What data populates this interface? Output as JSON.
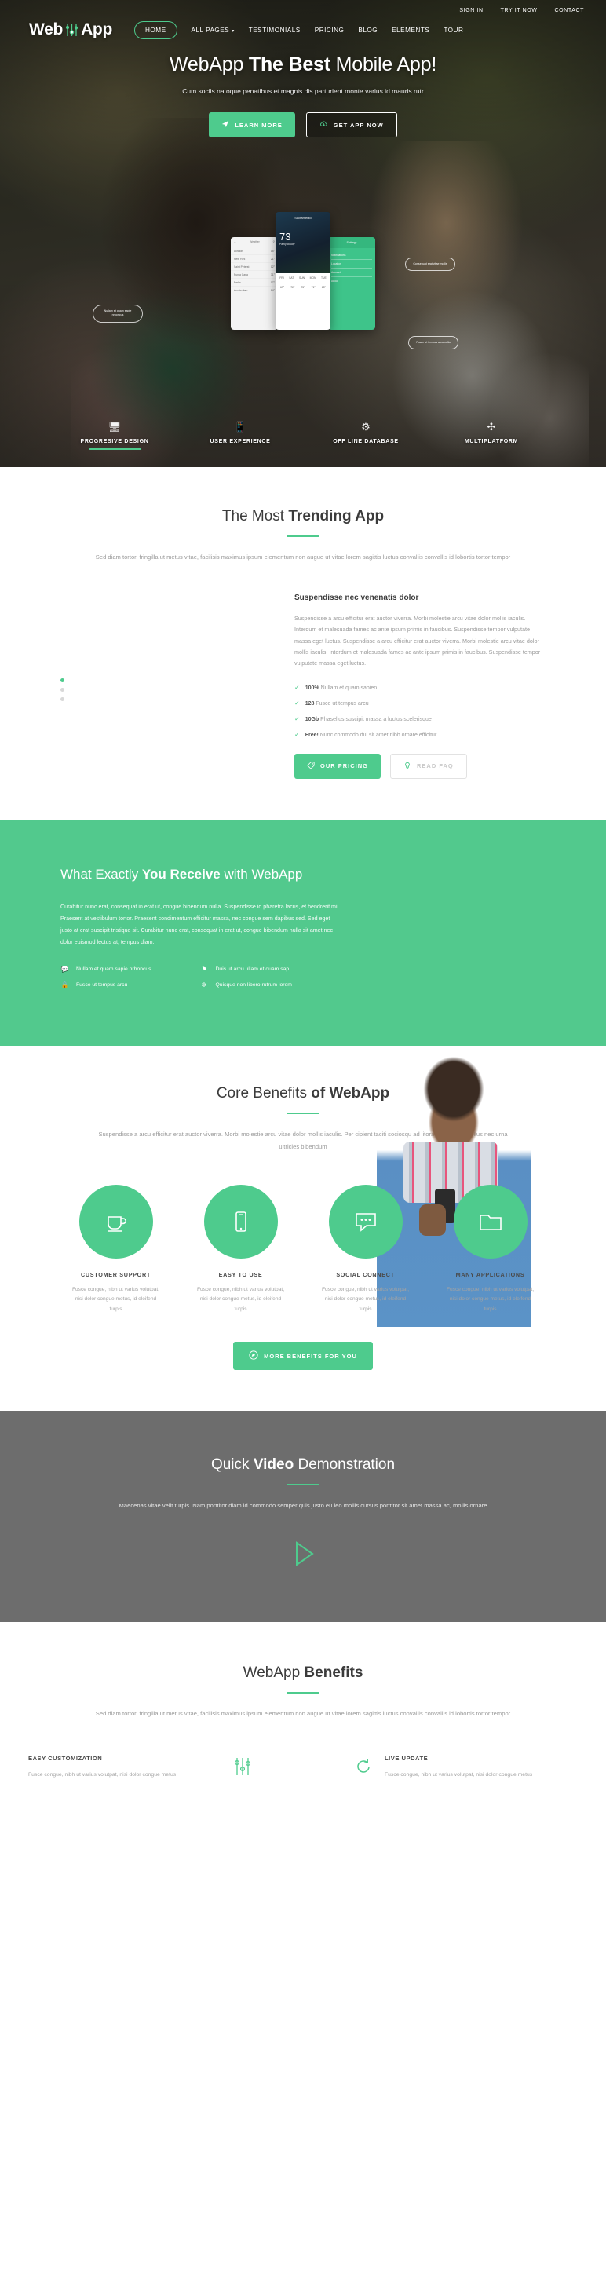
{
  "brand": {
    "name_light": "Web",
    "name_bold": "App",
    "logo_icon": "sliders-icon"
  },
  "accent": "#4ecb8d",
  "green_bg": "#52c98d",
  "utility_nav": [
    {
      "label": "SIGN IN"
    },
    {
      "label": "TRY IT NOW"
    },
    {
      "label": "CONTACT"
    }
  ],
  "main_nav": [
    {
      "label": "HOME",
      "active": true
    },
    {
      "label": "ALL PAGES",
      "caret": "⌵"
    },
    {
      "label": "TESTIMONIALS"
    },
    {
      "label": "PRICING"
    },
    {
      "label": "BLOG"
    },
    {
      "label": "ELEMENTS"
    },
    {
      "label": "TOUR"
    }
  ],
  "hero": {
    "title_pre": "WebApp ",
    "title_bold": "The Best",
    "title_post": " Mobile App!",
    "subtitle": "Cum sociis natoque penatibus et magnis dis parturient monte varius id mauris rutr",
    "buttons": [
      {
        "label": "LEARN MORE",
        "icon": "paper-plane-icon",
        "style": "green"
      },
      {
        "label": "GET APP NOW",
        "icon": "cloud-download-icon",
        "style": "ghost"
      }
    ],
    "callouts": [
      {
        "text": "Nullam et quam sapie nrhoncus"
      },
      {
        "text": "Consequat erat vitae mollis"
      },
      {
        "text": "Fusce ut tempus arcu nulla"
      }
    ],
    "features": [
      {
        "label": "PROGRESIVE DESIGN",
        "icon": "monitor-icon",
        "active": true
      },
      {
        "label": "USER EXPERIENCE",
        "icon": "mobile-icon",
        "active": false
      },
      {
        "label": "OFF LINE DATABASE",
        "icon": "gears-icon",
        "active": false
      },
      {
        "label": "MULTIPLATFORM",
        "icon": "compass-icon",
        "active": false
      }
    ],
    "phone_left": {
      "title": "Weather",
      "rows": [
        {
          "city": "London",
          "temp": "15°"
        },
        {
          "city": "New York",
          "temp": "21°"
        },
        {
          "city": "Saint Peterst",
          "temp": "12°"
        },
        {
          "city": "Punta Cana",
          "temp": "31°"
        },
        {
          "city": "Berlin",
          "temp": "17°"
        },
        {
          "city": "Amsterdam",
          "temp": "14°"
        }
      ]
    },
    "phone_mid": {
      "city": "Sacramento",
      "temp": "73",
      "condition": "Partly cloudy",
      "days": [
        "FRI",
        "SAT",
        "SUN",
        "MON",
        "TUE"
      ],
      "day_temps": [
        "69°",
        "72°",
        "75°",
        "71°",
        "68°"
      ]
    },
    "phone_right": {
      "title": "Settings",
      "rows": [
        "Notifications",
        "Location",
        "Account",
        "About"
      ]
    }
  },
  "trending": {
    "title_pre": "The Most ",
    "title_bold": "Trending App",
    "lead": "Sed diam tortor, fringilla ut metus vitae, facilisis maximus ipsum elementum non augue ut vitae lorem sagittis luctus convallis convallis id lobortis tortor tempor",
    "subhead": "Suspendisse nec venenatis dolor",
    "paragraph": "Suspendisse a arcu efficitur erat auctor viverra. Morbi molestie arcu vitae dolor mollis iaculis. Interdum et malesuada fames ac ante ipsum primis in faucibus. Suspendisse tempor vulputate massa eget luctus. Suspendisse a arcu efficitur erat auctor viverra. Morbi molestie arcu vitae dolor mollis iaculis. Interdum et malesuada fames ac ante ipsum primis in faucibus. Suspendisse tempor vulputate massa eget luctus.",
    "checks": [
      {
        "strong": "100%",
        "text": "Nullam et quam sapien."
      },
      {
        "strong": "128",
        "text": "Fusce ut tempus arcu"
      },
      {
        "strong": "10Gb",
        "text": "Phasellus suscipit massa a luctus scelerisque"
      },
      {
        "strong": "Free!",
        "text": "Nunc commodo dui sit amet nibh ornare efficitur"
      }
    ],
    "buttons": [
      {
        "label": "OUR PRICING",
        "icon": "tag-icon",
        "style": "green"
      },
      {
        "label": "READ FAQ",
        "icon": "lightbulb-icon",
        "style": "outline"
      }
    ]
  },
  "receive": {
    "title_pre": "What Exactly ",
    "title_bold": "You Receive",
    "title_post": " with WebApp",
    "paragraph": "Curabitur nunc erat, consequat in erat ut, congue bibendum nulla. Suspendisse id pharetra lacus, et hendrerit mi. Praesent at vestibulum tortor. Praesent condimentum efficitur massa, nec congue sem dapibus sed. Sed eget justo at erat suscipit tristique sit. Curabitur nunc erat, consequat in erat ut, congue bibendum nulla sit amet nec dolor euismod lectus at, tempus diam.",
    "items": [
      {
        "label": "Nullam et quam sapie nrhoncus",
        "icon": "comments-icon"
      },
      {
        "label": "Duis ut arcu ullam et quam sap",
        "icon": "flag-icon"
      },
      {
        "label": "Fusce ut tempus arcu",
        "icon": "lock-icon"
      },
      {
        "label": "Quisque non libero rutrum lorem",
        "icon": "sparkle-icon"
      }
    ]
  },
  "core": {
    "title_pre": "Core Benefits ",
    "title_bold": "of WebApp",
    "lead": "Suspendisse a arcu efficitur erat auctor viverra. Morbi molestie arcu vitae dolor mollis iaculis. Per cipient taciti sociosqu ad litora torquent vel tellus nec urna ultricies bibendum",
    "items": [
      {
        "title": "CUSTOMER SUPPORT",
        "icon": "coffee-cup-icon",
        "text": "Fusce congue, nibh ut varius volutpat, nisi dolor congue metus, id eleifend turpis"
      },
      {
        "title": "EASY TO USE",
        "icon": "mobile-icon",
        "text": "Fusce congue, nibh ut varius volutpat, nisi dolor congue metus, id eleifend turpis"
      },
      {
        "title": "SOCIAL CONNECT",
        "icon": "chat-bubble-icon",
        "text": "Fusce congue, nibh ut varius volutpat, nisi dolor congue metus, id eleifend turpis"
      },
      {
        "title": "MANY APPLICATIONS",
        "icon": "folder-icon",
        "text": "Fusce congue, nibh ut varius volutpat, nisi dolor congue metus, id eleifend turpis"
      }
    ],
    "cta": {
      "label": "MORE BENEFITS FOR YOU",
      "icon": "rocket-circle-icon"
    }
  },
  "video": {
    "title_pre": "Quick ",
    "title_bold": "Video",
    "title_post": " Demonstration",
    "lead": "Maecenas vitae velit turpis. Nam porttitor diam id commodo semper quis justo eu leo mollis cursus porttitor sit amet massa ac, mollis ornare",
    "play_icon": "play-triangle-icon"
  },
  "benefits": {
    "title_pre": "WebApp ",
    "title_bold": "Benefits",
    "lead": "Sed diam tortor, fringilla ut metus vitae, facilisis maximus ipsum elementum non augue ut vitae lorem sagittis luctus convallis convallis id lobortis tortor tempor",
    "items": [
      {
        "title": "EASY CUSTOMIZATION",
        "icon": "sliders-icon",
        "text": "Fusce congue, nibh ut varius volutpat, nisi dolor congue metus"
      },
      {
        "title": "LIVE UPDATE",
        "icon": "refresh-icon",
        "text": "Fusce congue, nibh ut varius volutpat, nisi dolor congue metus"
      }
    ]
  }
}
